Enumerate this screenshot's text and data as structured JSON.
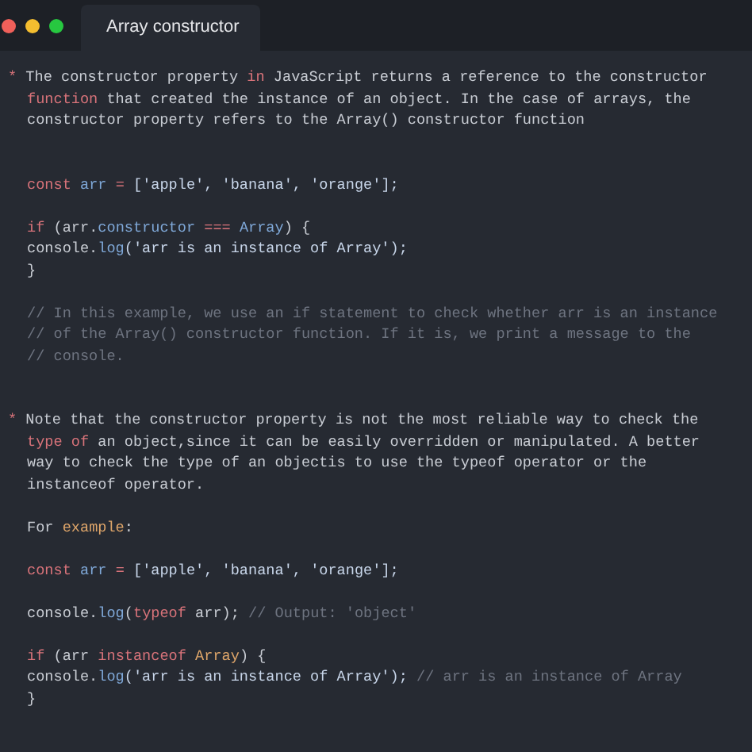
{
  "window": {
    "tab": {
      "title": "Array constructor",
      "selected": true
    }
  },
  "lines": [
    {
      "kind": "bullet",
      "tokens": [
        {
          "kind": "marker",
          "text": "*"
        },
        {
          "kind": "plain",
          "text": " The constructor property "
        },
        {
          "kind": "keyword",
          "text": "in"
        },
        {
          "kind": "plain",
          "text": " JavaScript returns a reference to the constructor"
        }
      ]
    },
    {
      "kind": "code",
      "tokens": [
        {
          "kind": "keyword",
          "text": "function"
        },
        {
          "kind": "plain",
          "text": " that created the instance of an object. In the case of arrays, the"
        }
      ]
    },
    {
      "kind": "code",
      "tokens": [
        {
          "kind": "plain",
          "text": "constructor property refers to the Array() constructor function"
        }
      ]
    },
    {
      "kind": "blank"
    },
    {
      "kind": "blank"
    },
    {
      "kind": "code",
      "tokens": [
        {
          "kind": "keyword",
          "text": "const"
        },
        {
          "kind": "variable",
          "text": " arr"
        },
        {
          "kind": "keyword",
          "text": " = "
        },
        {
          "kind": "string",
          "text": "['apple', 'banana', 'orange'];"
        }
      ]
    },
    {
      "kind": "blank"
    },
    {
      "kind": "code",
      "tokens": [
        {
          "kind": "keyword",
          "text": "if"
        },
        {
          "kind": "plain",
          "text": " (arr."
        },
        {
          "kind": "variable",
          "text": "constructor"
        },
        {
          "kind": "keyword",
          "text": " === "
        },
        {
          "kind": "variable",
          "text": "Array"
        },
        {
          "kind": "plain",
          "text": ") {"
        }
      ]
    },
    {
      "kind": "code",
      "tokens": [
        {
          "kind": "plain",
          "text": "console."
        },
        {
          "kind": "variable",
          "text": "log"
        },
        {
          "kind": "string",
          "text": "('arr is an instance of Array');"
        }
      ]
    },
    {
      "kind": "code",
      "tokens": [
        {
          "kind": "plain",
          "text": "}"
        }
      ]
    },
    {
      "kind": "blank"
    },
    {
      "kind": "code",
      "tokens": [
        {
          "kind": "comment",
          "text": "// In this example, we use an if statement to check whether arr is an instance"
        }
      ]
    },
    {
      "kind": "code",
      "tokens": [
        {
          "kind": "comment",
          "text": "// of the Array() constructor function. If it is, we print a message to the"
        }
      ]
    },
    {
      "kind": "code",
      "tokens": [
        {
          "kind": "comment",
          "text": "// console."
        }
      ]
    },
    {
      "kind": "blank"
    },
    {
      "kind": "blank"
    },
    {
      "kind": "bullet",
      "tokens": [
        {
          "kind": "marker",
          "text": "*"
        },
        {
          "kind": "plain",
          "text": " Note that the constructor property is not the most reliable way to check the"
        }
      ]
    },
    {
      "kind": "code",
      "tokens": [
        {
          "kind": "keyword",
          "text": "type of"
        },
        {
          "kind": "plain",
          "text": " an object,since it can be easily overridden or manipulated. A better"
        }
      ]
    },
    {
      "kind": "code",
      "tokens": [
        {
          "kind": "plain",
          "text": "way to check the type of an objectis to use the typeof operator or the"
        }
      ]
    },
    {
      "kind": "code",
      "tokens": [
        {
          "kind": "plain",
          "text": "instanceof operator."
        }
      ]
    },
    {
      "kind": "blank"
    },
    {
      "kind": "code",
      "tokens": [
        {
          "kind": "plain",
          "text": "For "
        },
        {
          "kind": "type",
          "text": "example"
        },
        {
          "kind": "plain",
          "text": ":"
        }
      ]
    },
    {
      "kind": "blank"
    },
    {
      "kind": "code",
      "tokens": [
        {
          "kind": "keyword",
          "text": "const"
        },
        {
          "kind": "variable",
          "text": " arr"
        },
        {
          "kind": "keyword",
          "text": " = "
        },
        {
          "kind": "string",
          "text": "['apple', 'banana', 'orange'];"
        }
      ]
    },
    {
      "kind": "blank"
    },
    {
      "kind": "code",
      "tokens": [
        {
          "kind": "plain",
          "text": "console."
        },
        {
          "kind": "variable",
          "text": "log"
        },
        {
          "kind": "plain",
          "text": "("
        },
        {
          "kind": "keyword",
          "text": "typeof"
        },
        {
          "kind": "plain",
          "text": " arr); "
        },
        {
          "kind": "comment",
          "text": "// Output: 'object'"
        }
      ]
    },
    {
      "kind": "blank"
    },
    {
      "kind": "code",
      "tokens": [
        {
          "kind": "keyword",
          "text": "if"
        },
        {
          "kind": "plain",
          "text": " (arr "
        },
        {
          "kind": "keyword",
          "text": "instanceof"
        },
        {
          "kind": "type",
          "text": " Array"
        },
        {
          "kind": "plain",
          "text": ") {"
        }
      ]
    },
    {
      "kind": "code",
      "tokens": [
        {
          "kind": "plain",
          "text": "console."
        },
        {
          "kind": "variable",
          "text": "log"
        },
        {
          "kind": "string",
          "text": "('arr is an instance of Array');"
        },
        {
          "kind": "comment",
          "text": " // arr is an instance of Array"
        }
      ]
    },
    {
      "kind": "code",
      "tokens": [
        {
          "kind": "plain",
          "text": "}"
        }
      ]
    }
  ]
}
